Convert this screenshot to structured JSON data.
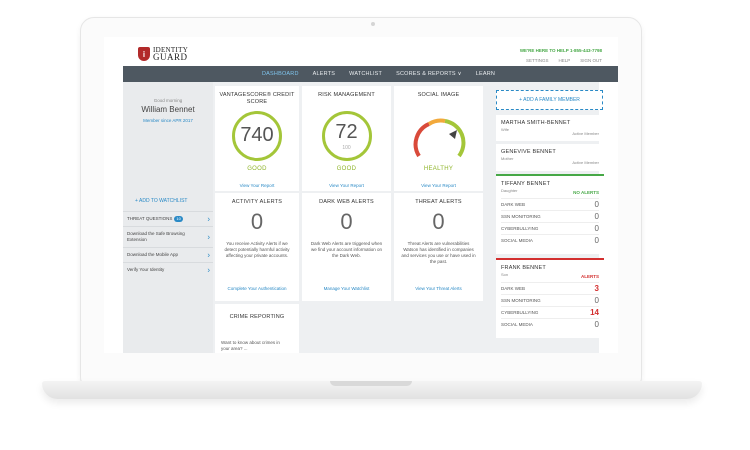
{
  "brand": {
    "line1": "IDENTITY",
    "line2": "GUARD"
  },
  "header": {
    "help": "WE'RE HERE TO HELP 1-855-443-7798",
    "links": [
      "SETTINGS",
      "HELP",
      "SIGN OUT"
    ]
  },
  "nav": {
    "items": [
      "DASHBOARD",
      "ALERTS",
      "WATCHLIST",
      "SCORES & REPORTS ∨",
      "LEARN"
    ]
  },
  "sidebar": {
    "greeting": "Good morning",
    "name": "William Bennet",
    "member_since": "Member since APR 2017",
    "add_watchlist": "+ ADD TO WATCHLIST",
    "items": [
      {
        "label": "THREAT QUESTIONS",
        "badge": "10"
      },
      {
        "label": "Download the Safe Browsing Extension"
      },
      {
        "label": "Download the Mobile App"
      },
      {
        "label": "Verify Your Identity"
      }
    ]
  },
  "cards": {
    "credit": {
      "title": "VANTAGESCORE® CREDIT SCORE",
      "value": "740",
      "status": "GOOD",
      "link": "View Your Report"
    },
    "risk": {
      "title": "RISK MANAGEMENT",
      "value": "72",
      "sub": "100",
      "status": "GOOD",
      "link": "View Your Report"
    },
    "social": {
      "title": "SOCIAL IMAGE",
      "status": "HEALTHY",
      "link": "View Your Report"
    },
    "activity": {
      "title": "ACTIVITY ALERTS",
      "value": "0",
      "desc": "You receive Activity Alerts if we detect potentially harmful activity affecting your private accounts.",
      "link": "Complete Your Authentication"
    },
    "darkweb": {
      "title": "DARK WEB ALERTS",
      "value": "0",
      "desc": "Dark Web Alerts are triggered when we find your account information on the Dark Web.",
      "link": "Manage Your Watchlist"
    },
    "threat": {
      "title": "THREAT ALERTS",
      "value": "0",
      "desc": "Threat Alerts are vulnerabilities Watson has identified in companies and services you use or have used in the past.",
      "link": "View Your Threat Alerts"
    },
    "crime": {
      "title": "CRIME REPORTING",
      "desc": "Want to know about crimes in your area? ..."
    }
  },
  "family": {
    "add_label": "+ ADD A FAMILY MEMBER",
    "members": [
      {
        "name": "MARTHA SMITH-BENNET",
        "relation": "Wife",
        "status": "Active Member"
      },
      {
        "name": "GENEVIVE BENNET",
        "relation": "Mother",
        "status": "Active Member"
      },
      {
        "name": "TIFFANY BENNET",
        "relation": "Daughter",
        "tag": "NO ALERTS",
        "rows": [
          {
            "label": "DARK WEB",
            "value": "0"
          },
          {
            "label": "SSN MONITORING",
            "value": "0"
          },
          {
            "label": "CYBERBULLYING",
            "value": "0"
          },
          {
            "label": "SOCIAL MEDIA",
            "value": "0"
          }
        ]
      },
      {
        "name": "FRANK BENNET",
        "relation": "Son",
        "tag": "ALERTS",
        "rows": [
          {
            "label": "DARK WEB",
            "value": "3"
          },
          {
            "label": "SSN MONITORING",
            "value": "0"
          },
          {
            "label": "CYBERBULLYING",
            "value": "14"
          },
          {
            "label": "SOCIAL MEDIA",
            "value": "0"
          }
        ]
      }
    ]
  },
  "colors": {
    "nav": "#4e5861",
    "accent": "#2a8ac6",
    "good": "#a4c639",
    "alert": "#d32f2f",
    "ok": "#47a847"
  }
}
